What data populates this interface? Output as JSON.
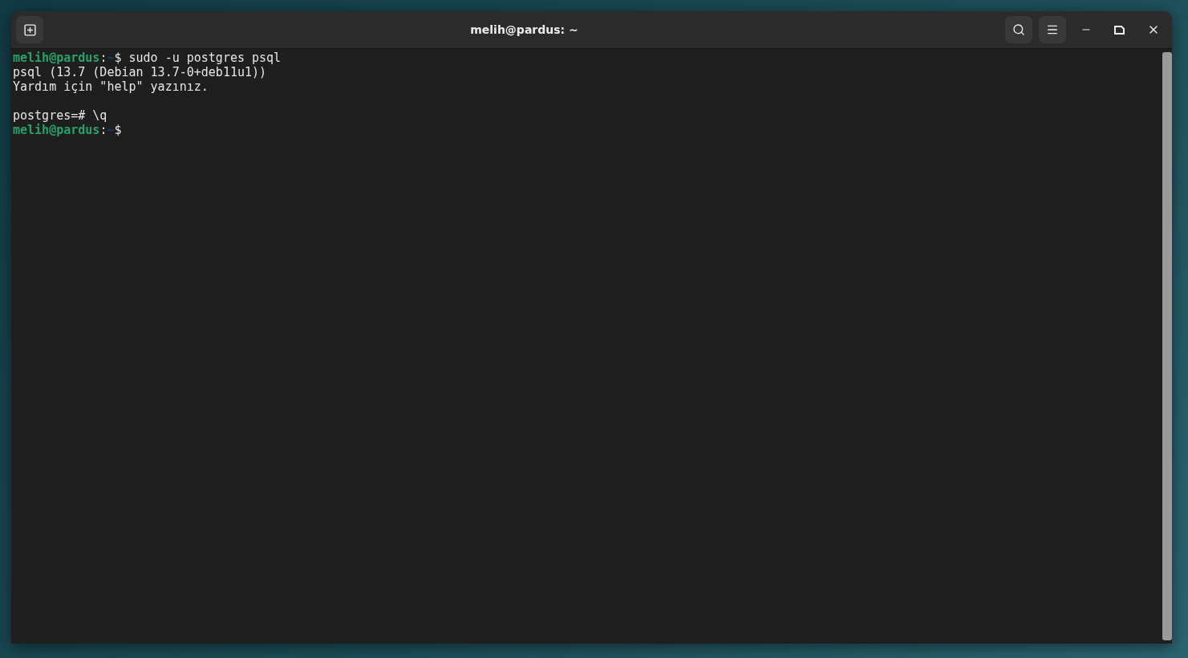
{
  "window": {
    "title": "melih@pardus: ~"
  },
  "terminal": {
    "lines": [
      {
        "segments": [
          {
            "kind": "prompt",
            "text": "melih@pardus"
          },
          {
            "kind": "plain",
            "text": ":"
          },
          {
            "kind": "path",
            "text": "~"
          },
          {
            "kind": "plain",
            "text": "$ sudo -u postgres psql"
          }
        ]
      },
      {
        "segments": [
          {
            "kind": "plain",
            "text": "psql (13.7 (Debian 13.7-0+deb11u1))"
          }
        ]
      },
      {
        "segments": [
          {
            "kind": "plain",
            "text": "Yardım için \"help\" yazınız."
          }
        ]
      },
      {
        "blank_before": true,
        "segments": [
          {
            "kind": "plain",
            "text": "postgres=# \\q"
          }
        ]
      },
      {
        "segments": [
          {
            "kind": "prompt",
            "text": "melih@pardus"
          },
          {
            "kind": "plain",
            "text": ":"
          },
          {
            "kind": "path",
            "text": "~"
          },
          {
            "kind": "plain",
            "text": "$"
          }
        ]
      }
    ]
  }
}
